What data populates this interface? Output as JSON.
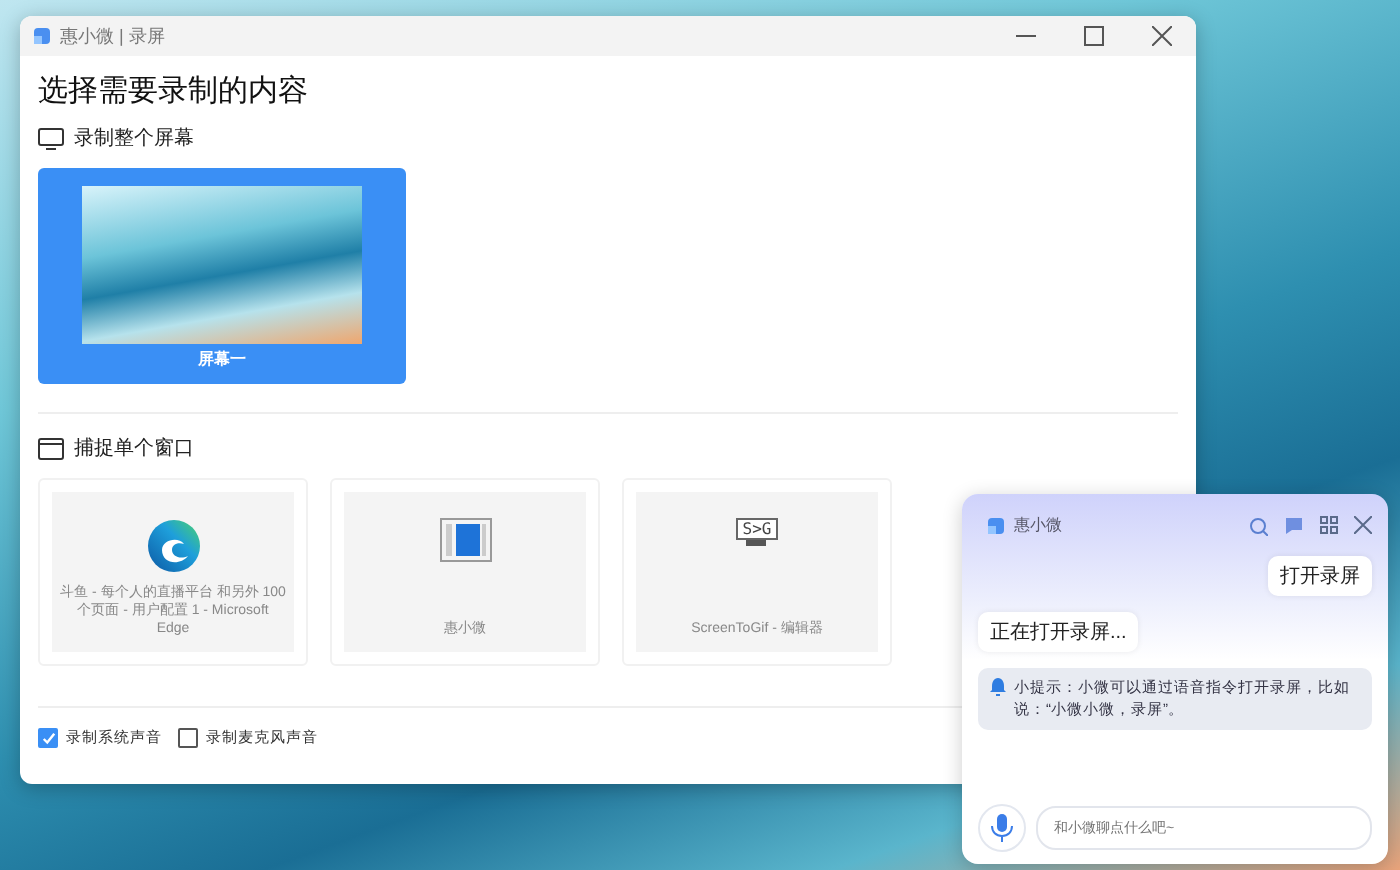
{
  "window": {
    "title": "惠小微 | 录屏"
  },
  "heading": "选择需要录制的内容",
  "full_screen_section": {
    "label": "录制整个屏幕",
    "screens": [
      {
        "label": "屏幕一",
        "selected": true
      }
    ]
  },
  "window_section": {
    "label": "捕捉单个窗口",
    "windows": [
      {
        "kind": "browser",
        "title": "斗鱼 - 每个人的直播平台 和另外 100 个页面 - 用户配置 1 - Microsoft Edge"
      },
      {
        "kind": "app",
        "title": "惠小微"
      },
      {
        "kind": "monitor",
        "icon_text": "S>G",
        "title": "ScreenToGif - 编辑器"
      }
    ]
  },
  "options": [
    {
      "label": "录制系统声音",
      "checked": true
    },
    {
      "label": "录制麦克风声音",
      "checked": false
    }
  ],
  "assistant": {
    "title": "惠小微",
    "messages": [
      {
        "kind": "user",
        "text": "打开录屏"
      },
      {
        "kind": "bot",
        "text": "正在打开录屏..."
      },
      {
        "kind": "tip",
        "text": "小提示：小微可以通过语音指令打开录屏，比如说：“小微小微，录屏”。"
      }
    ],
    "input": {
      "placeholder": "和小微聊点什么吧~"
    }
  }
}
